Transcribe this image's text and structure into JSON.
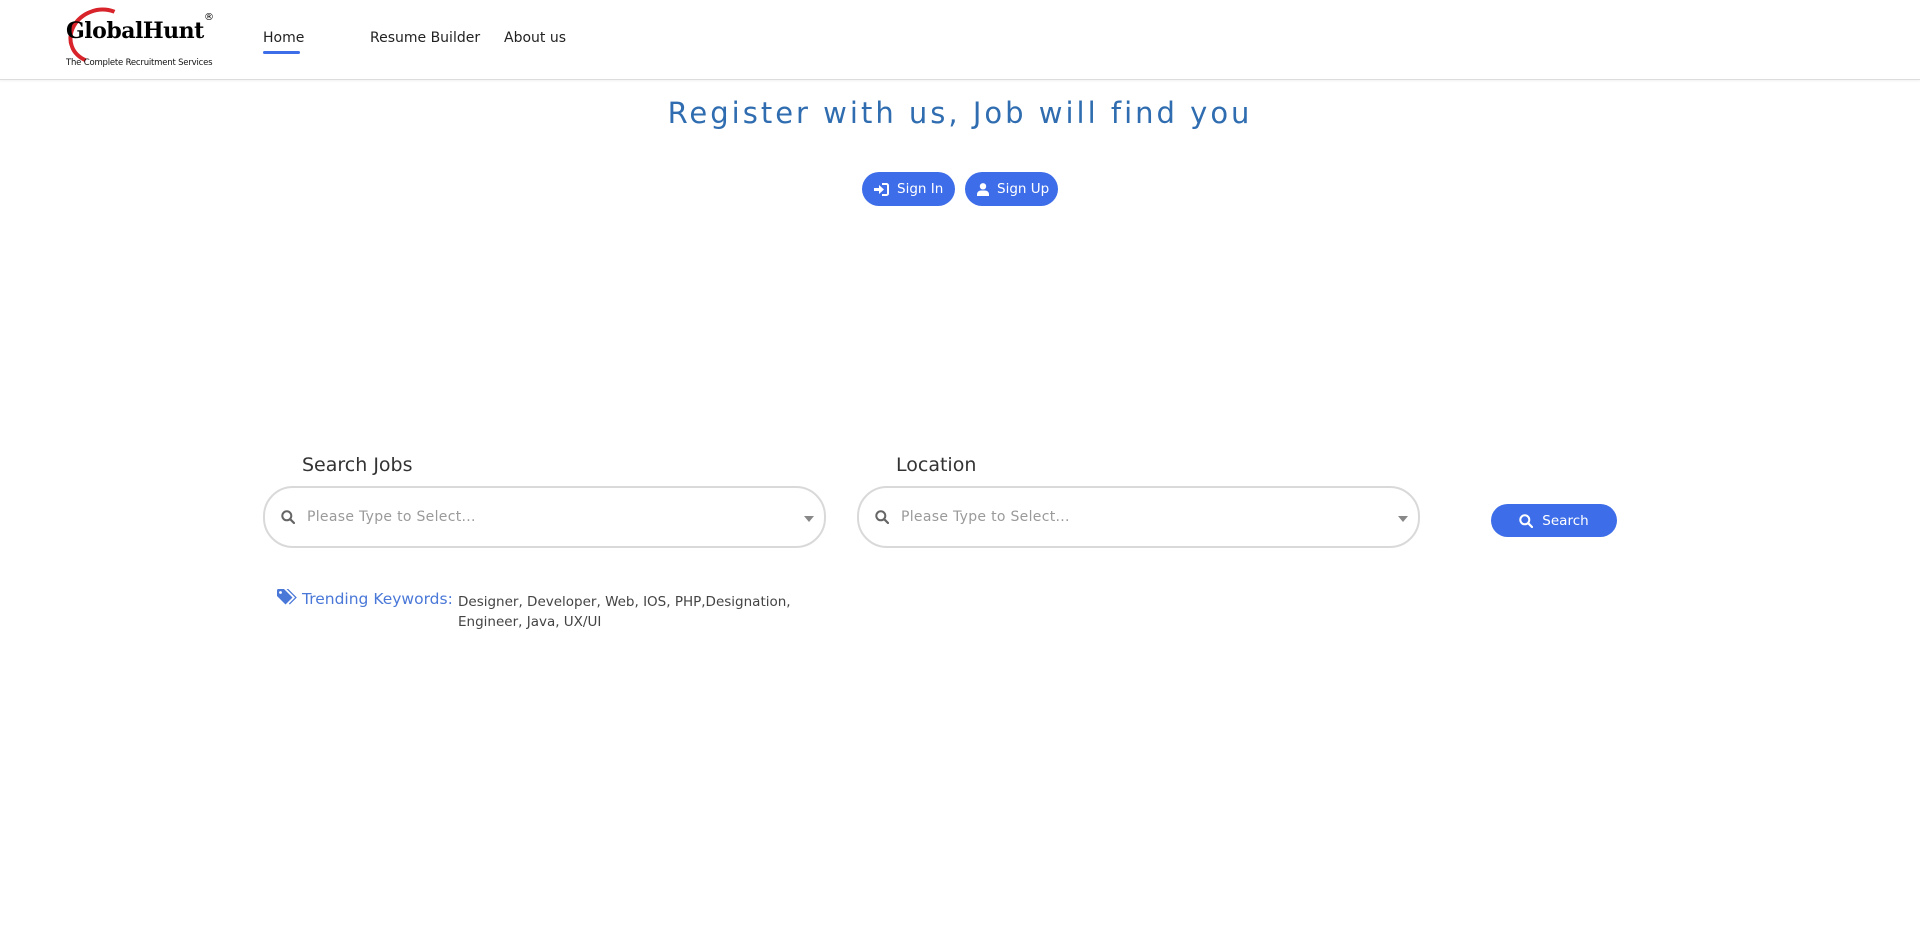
{
  "header": {
    "logo": {
      "wordmark": "GlobalHunt",
      "registered": "®",
      "tagline": "The Complete Recruitment Services"
    },
    "nav": [
      {
        "label": "Home",
        "active": true
      },
      {
        "label": "Resume Builder",
        "active": false
      },
      {
        "label": "About us",
        "active": false
      }
    ]
  },
  "hero": {
    "title": "Register with us, Job will find you",
    "sign_in_label": "Sign In",
    "sign_up_label": "Sign Up"
  },
  "search": {
    "jobs_label": "Search Jobs",
    "jobs_placeholder": "Please Type to Select...",
    "location_label": "Location",
    "location_placeholder": "Please Type to Select...",
    "search_button": "Search"
  },
  "trending": {
    "label": "Trending Keywords:",
    "keywords": "Designer, Developer, Web, IOS, PHP,Designation, Engineer, Java, UX/UI"
  },
  "icons": {
    "sign_in": "sign-in-icon",
    "sign_up": "user-icon",
    "search": "search-icon",
    "tags": "tags-icon"
  },
  "colors": {
    "accent": "#3d6de8",
    "title": "#2f6db0",
    "trending_label": "#4a78d8",
    "logo_red": "#d8232a"
  }
}
